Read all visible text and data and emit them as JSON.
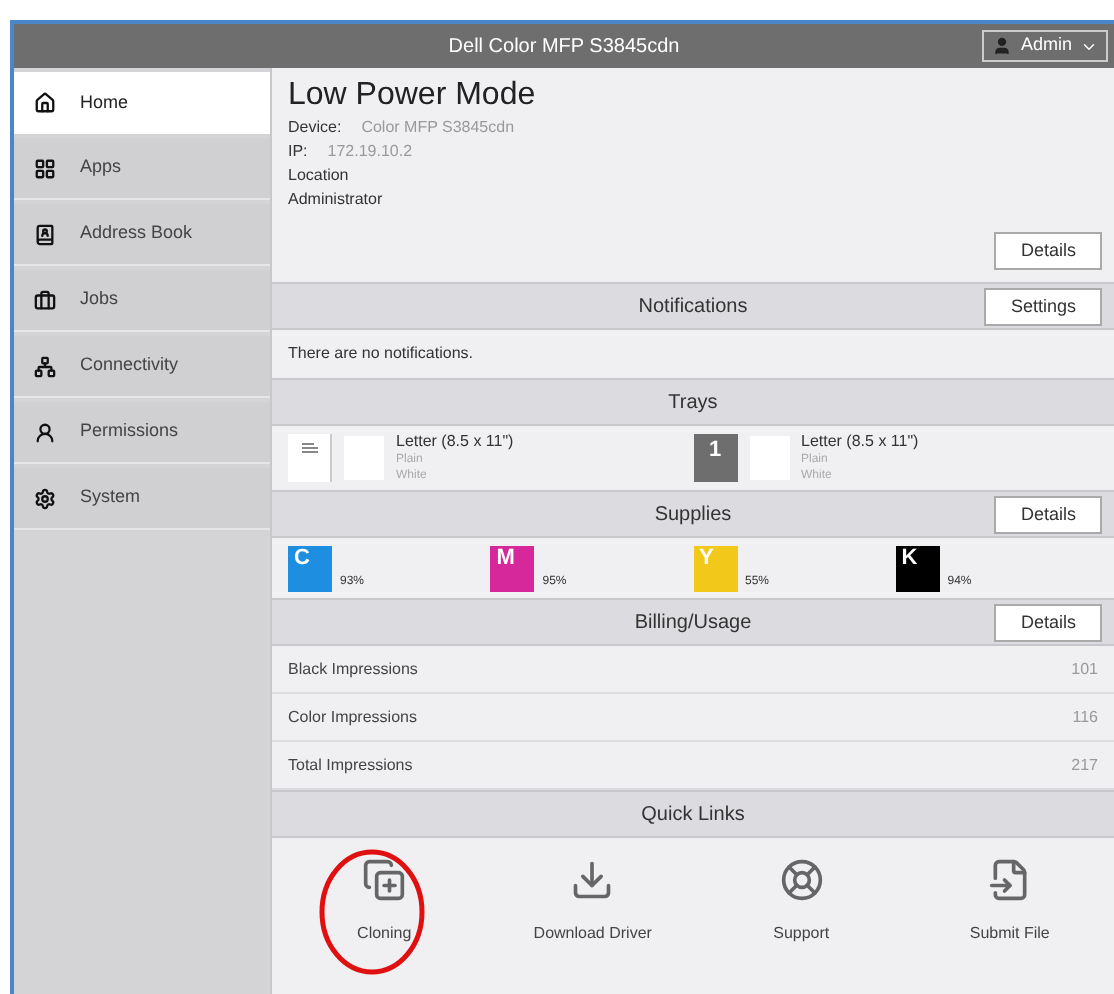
{
  "header": {
    "title": "Dell Color MFP S3845cdn",
    "user_menu": "Admin"
  },
  "sidebar": {
    "items": [
      {
        "label": "Home",
        "selected": true
      },
      {
        "label": "Apps",
        "selected": false
      },
      {
        "label": "Address Book",
        "selected": false
      },
      {
        "label": "Jobs",
        "selected": false
      },
      {
        "label": "Connectivity",
        "selected": false
      },
      {
        "label": "Permissions",
        "selected": false
      },
      {
        "label": "System",
        "selected": false
      }
    ]
  },
  "status": {
    "title": "Low Power Mode",
    "fields": [
      {
        "label": "Device:",
        "value": "Color MFP S3845cdn"
      },
      {
        "label": "IP:",
        "value": "172.19.10.2"
      },
      {
        "label": "Location"
      },
      {
        "label": "Administrator"
      }
    ],
    "button": "Details"
  },
  "notifications": {
    "title": "Notifications",
    "button": "Settings",
    "message": "There are no notifications."
  },
  "trays": {
    "title": "Trays",
    "items": [
      {
        "kind": "bypass",
        "size": "Letter (8.5 x 11\")",
        "type": "Plain",
        "color_name": "White"
      },
      {
        "kind": "numbered",
        "number": "1",
        "size": "Letter (8.5 x 11\")",
        "type": "Plain",
        "color_name": "White"
      }
    ]
  },
  "supplies": {
    "title": "Supplies",
    "button": "Details",
    "items": [
      {
        "letter": "C",
        "color": "#1e8fe0",
        "percent": "93%"
      },
      {
        "letter": "M",
        "color": "#d6289a",
        "percent": "95%"
      },
      {
        "letter": "Y",
        "color": "#f2c91a",
        "percent": "55%"
      },
      {
        "letter": "K",
        "color": "#000000",
        "percent": "94%"
      }
    ]
  },
  "billing": {
    "title": "Billing/Usage",
    "button": "Details",
    "rows": [
      {
        "label": "Black Impressions",
        "value": "101"
      },
      {
        "label": "Color Impressions",
        "value": "116"
      },
      {
        "label": "Total Impressions",
        "value": "217"
      }
    ]
  },
  "quick_links": {
    "title": "Quick Links",
    "items": [
      {
        "label": "Cloning",
        "circled": true
      },
      {
        "label": "Download Driver",
        "circled": false
      },
      {
        "label": "Support",
        "circled": false
      },
      {
        "label": "Submit File",
        "circled": false
      }
    ]
  }
}
